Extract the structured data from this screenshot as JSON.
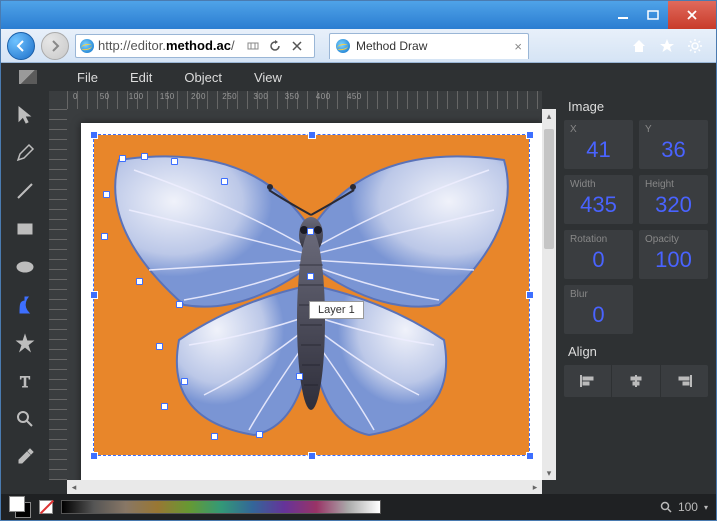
{
  "browser": {
    "url_prefix": "http://editor.",
    "url_host": "method.ac",
    "url_suffix": "/",
    "tab_title": "Method Draw"
  },
  "menubar": {
    "file": "File",
    "edit": "Edit",
    "object": "Object",
    "view": "View"
  },
  "layer_label": "Layer 1",
  "panel": {
    "title": "Image",
    "x_label": "X",
    "x_value": "41",
    "y_label": "Y",
    "y_value": "36",
    "width_label": "Width",
    "width_value": "435",
    "height_label": "Height",
    "height_value": "320",
    "rotation_label": "Rotation",
    "rotation_value": "0",
    "opacity_label": "Opacity",
    "opacity_value": "100",
    "blur_label": "Blur",
    "blur_value": "0",
    "align_title": "Align"
  },
  "zoom": {
    "value": "100"
  }
}
